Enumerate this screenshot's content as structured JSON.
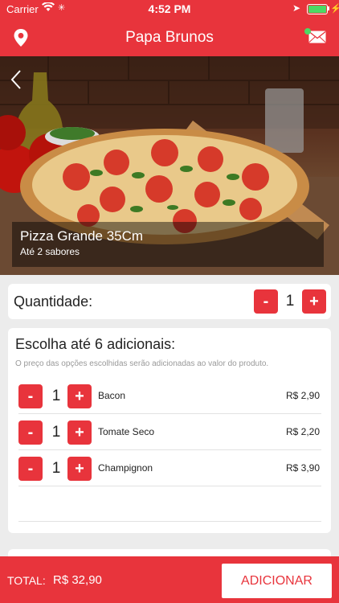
{
  "status": {
    "carrier": "Carrier",
    "time": "4:52 PM"
  },
  "nav": {
    "title": "Papa Brunos"
  },
  "product": {
    "name": "Pizza Grande 35Cm",
    "subtitle": "Até 2 sabores"
  },
  "quantity": {
    "label": "Quantidade:",
    "value": "1",
    "minus": "-",
    "plus": "+"
  },
  "addons": {
    "title": "Escolha até 6 adicionais:",
    "note": "O preço das opções escolhidas serão adicionadas ao valor do produto.",
    "items": [
      {
        "name": "Bacon",
        "qty": "1",
        "price": "R$ 2,90",
        "minus": "-",
        "plus": "+"
      },
      {
        "name": "Tomate Seco",
        "qty": "1",
        "price": "R$ 2,20",
        "minus": "-",
        "plus": "+"
      },
      {
        "name": "Champignon",
        "qty": "1",
        "price": "R$ 3,90",
        "minus": "-",
        "plus": "+"
      }
    ]
  },
  "footer": {
    "total_label": "TOTAL:",
    "total_value": "R$ 32,90",
    "add_label": "ADICIONAR"
  },
  "colors": {
    "brand": "#e8343c",
    "background": "#ececec"
  },
  "icons": {
    "nav_left": "location-pin-icon",
    "nav_right": "mail-icon",
    "back": "chevron-left-icon"
  }
}
